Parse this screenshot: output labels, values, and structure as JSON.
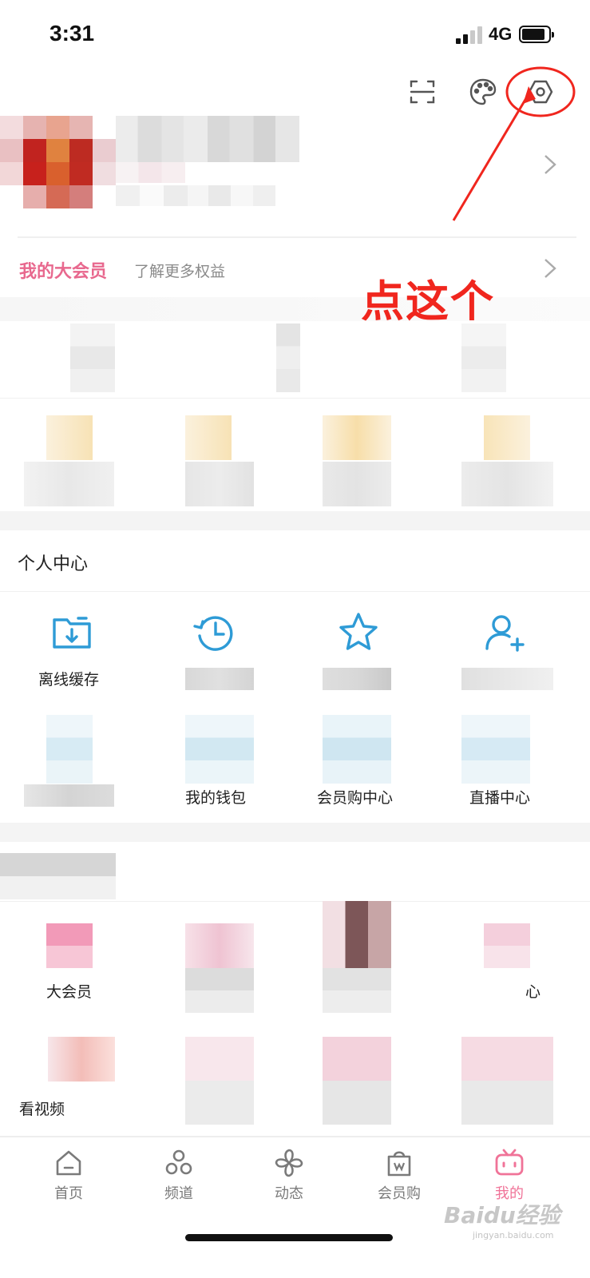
{
  "status_bar": {
    "time": "3:31",
    "network": "4G"
  },
  "header": {
    "icons": [
      "scan-icon",
      "theme-palette-icon",
      "settings-icon"
    ]
  },
  "vip": {
    "title": "我的大会员",
    "subtitle": "了解更多权益"
  },
  "personal_center": {
    "title": "个人中心",
    "items": [
      {
        "label": "离线缓存",
        "icon": "offline-cache-icon"
      },
      {
        "label": "",
        "icon": "history-icon"
      },
      {
        "label": "",
        "icon": "favorites-star-icon"
      },
      {
        "label": "",
        "icon": "add-friend-icon"
      },
      {
        "label": "",
        "icon": "blurred-icon"
      },
      {
        "label": "我的钱包",
        "icon": "wallet-icon"
      },
      {
        "label": "会员购中心",
        "icon": "shop-center-icon"
      },
      {
        "label": "直播中心",
        "icon": "live-center-icon"
      }
    ]
  },
  "services": {
    "items": [
      {
        "label": "大会员",
        "icon": "vip-icon"
      },
      {
        "label": "",
        "icon": "blurred-icon"
      },
      {
        "label": "",
        "icon": "blurred-icon"
      },
      {
        "label": "心",
        "icon": "blurred-icon"
      },
      {
        "label": "看视频",
        "icon": "blurred-icon"
      }
    ]
  },
  "bottom_nav": {
    "items": [
      {
        "label": "首页",
        "icon": "home-icon"
      },
      {
        "label": "频道",
        "icon": "channel-icon"
      },
      {
        "label": "动态",
        "icon": "dynamic-pinwheel-icon"
      },
      {
        "label": "会员购",
        "icon": "shopping-bag-icon"
      },
      {
        "label": "我的",
        "icon": "tv-mine-icon",
        "active": true
      }
    ]
  },
  "annotation": {
    "text": "点这个"
  },
  "watermark": {
    "text": "Baidu经验",
    "sub": "jingyan.baidu.com"
  },
  "colors": {
    "accent_pink": "#f07398",
    "vip_pink": "#e8688e",
    "icon_blue": "#2e9bd6",
    "annotation_red": "#f0261e"
  }
}
